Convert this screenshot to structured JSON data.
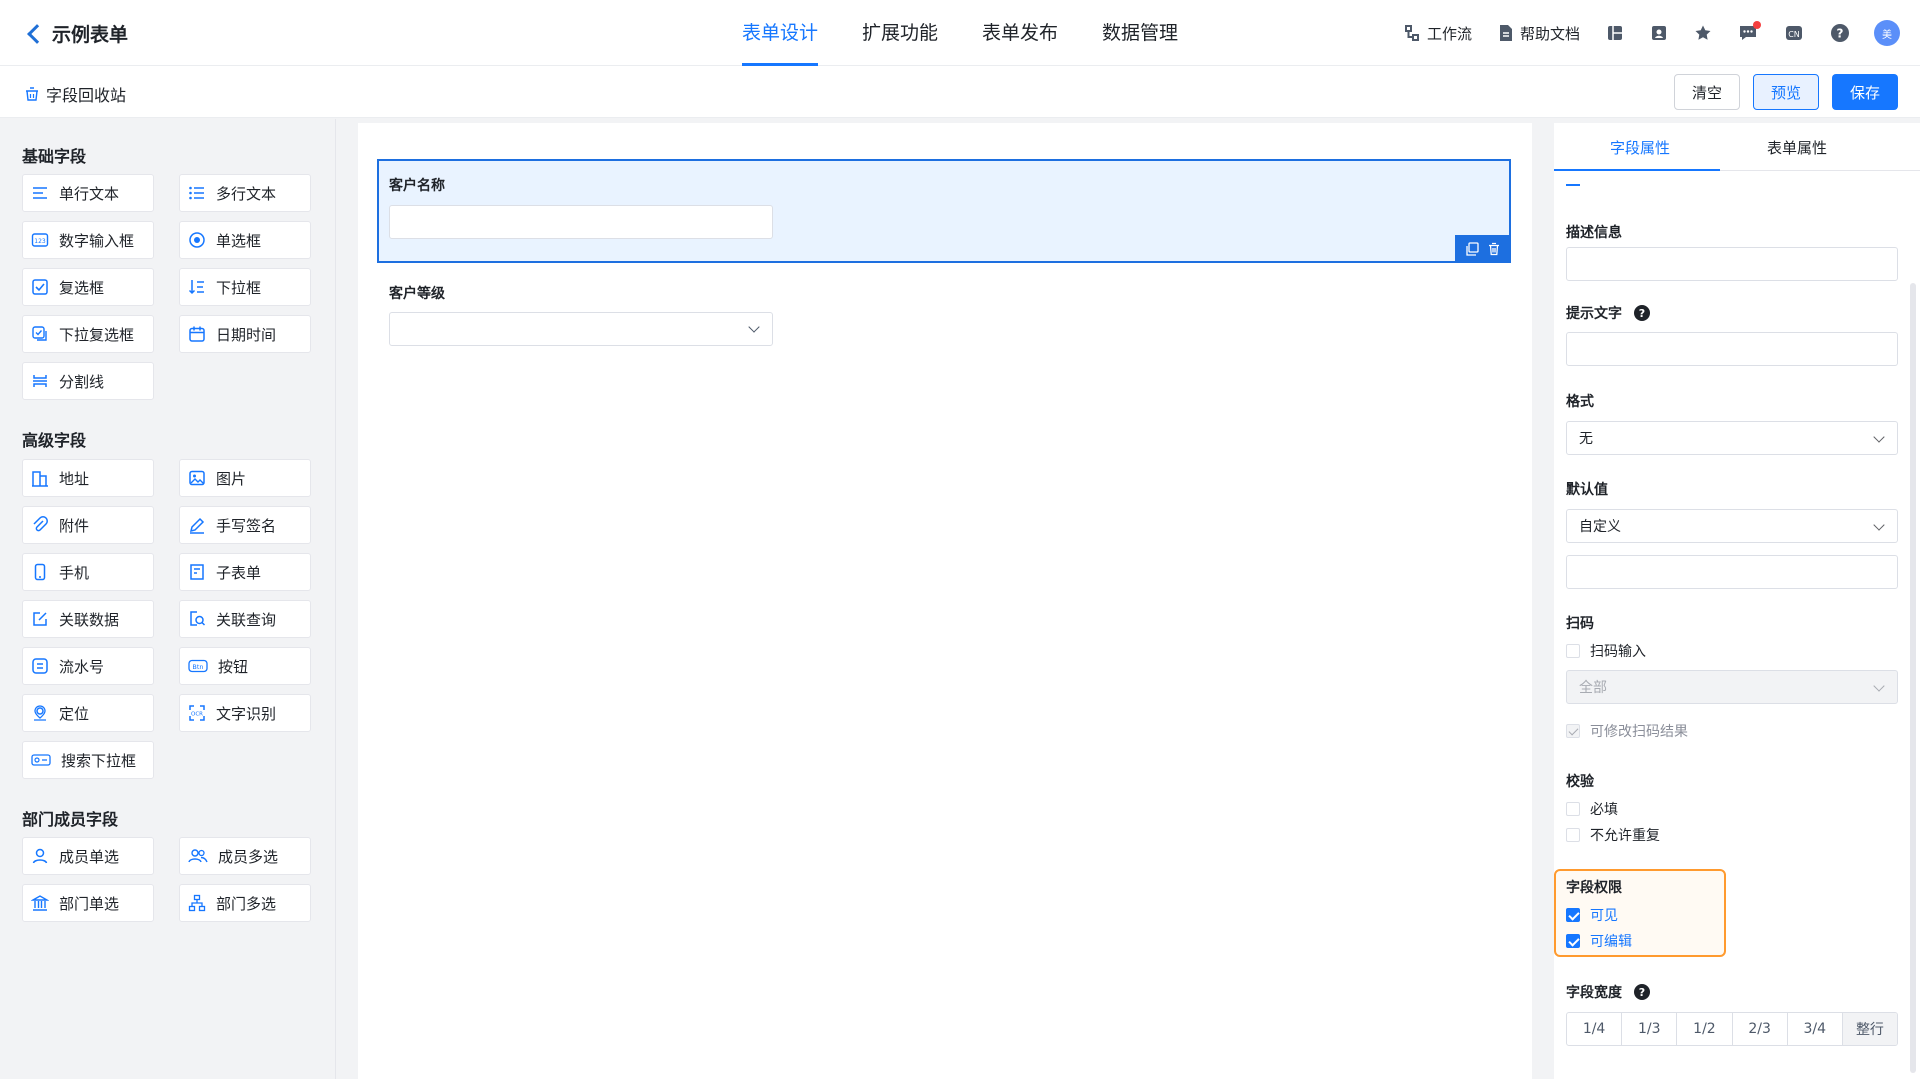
{
  "header": {
    "app_title": "示例表单",
    "tabs": [
      {
        "label": "表单设计",
        "active": true
      },
      {
        "label": "扩展功能"
      },
      {
        "label": "表单发布"
      },
      {
        "label": "数据管理"
      }
    ],
    "workflow_label": "工作流",
    "help_docs_label": "帮助文档",
    "avatar_text": "美",
    "accent_color": "#1677ff"
  },
  "subbar": {
    "recycle_label": "字段回收站",
    "clear_label": "清空",
    "preview_label": "预览",
    "save_label": "保存"
  },
  "palette": {
    "basic_title": "基础字段",
    "basic": [
      "单行文本",
      "多行文本",
      "数字输入框",
      "单选框",
      "复选框",
      "下拉框",
      "下拉复选框",
      "日期时间",
      "分割线"
    ],
    "advanced_title": "高级字段",
    "advanced": [
      "地址",
      "图片",
      "附件",
      "手写签名",
      "手机",
      "子表单",
      "关联数据",
      "关联查询",
      "流水号",
      "按钮",
      "定位",
      "文字识别",
      "搜索下拉框"
    ],
    "member_title": "部门成员字段",
    "member": [
      "成员单选",
      "成员多选",
      "部门单选",
      "部门多选"
    ]
  },
  "canvas": {
    "fields": [
      {
        "label": "客户名称",
        "type": "text",
        "selected": true
      },
      {
        "label": "客户等级",
        "type": "select",
        "selected": false
      }
    ]
  },
  "props": {
    "tab_field": "字段属性",
    "tab_form": "表单属性",
    "desc_label": "描述信息",
    "hint_label": "提示文字",
    "format_label": "格式",
    "format_value": "无",
    "default_label": "默认值",
    "default_value": "自定义",
    "scan_label": "扫码",
    "scan_input": "扫码输入",
    "scan_scope": "全部",
    "scan_editable": "可修改扫码结果",
    "verify_label": "校验",
    "required": "必填",
    "no_dup": "不允许重复",
    "perm_label": "字段权限",
    "visible": "可见",
    "editable": "可编辑",
    "width_label": "字段宽度",
    "widths": [
      "1/4",
      "1/3",
      "1/2",
      "2/3",
      "3/4",
      "整行"
    ],
    "highlight_color": "#ff9a2e"
  }
}
